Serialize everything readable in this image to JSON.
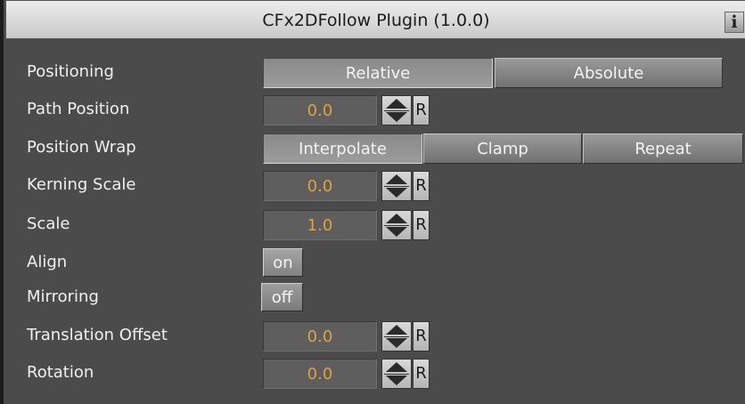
{
  "panel": {
    "title": "CFx2DFollow Plugin (1.0.0)",
    "info_label": "i"
  },
  "positioning": {
    "label": "Positioning",
    "options": [
      "Relative",
      "Absolute"
    ],
    "selected": "Relative"
  },
  "path_position": {
    "label": "Path Position",
    "value": "0.0",
    "reset_label": "R"
  },
  "position_wrap": {
    "label": "Position Wrap",
    "options": [
      "Interpolate",
      "Clamp",
      "Repeat"
    ],
    "selected": "Interpolate"
  },
  "kerning_scale": {
    "label": "Kerning Scale",
    "value": "0.0",
    "reset_label": "R"
  },
  "scale": {
    "label": "Scale",
    "value": "1.0",
    "reset_label": "R"
  },
  "align": {
    "label": "Align",
    "value": "on"
  },
  "mirroring": {
    "label": "Mirroring",
    "value": "off"
  },
  "translation_offset": {
    "label": "Translation Offset",
    "value": "0.0",
    "reset_label": "R"
  },
  "rotation": {
    "label": "Rotation",
    "value": "0.0",
    "reset_label": "R"
  },
  "colors": {
    "background": "#4b4b4b",
    "value_text": "#e0a23c",
    "label_text": "#f0f0f0"
  }
}
